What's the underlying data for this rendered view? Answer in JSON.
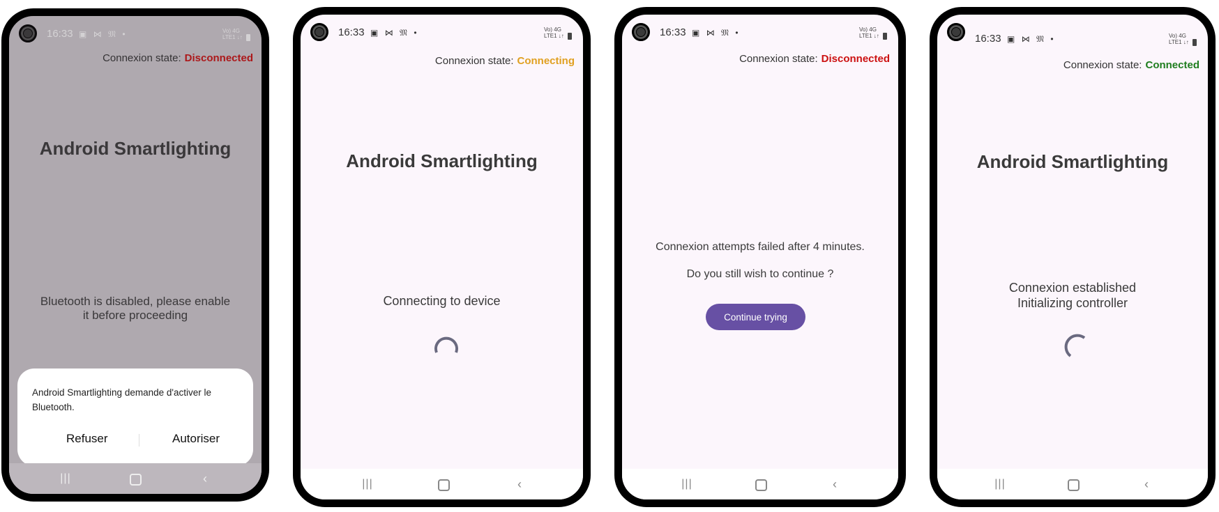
{
  "status_bar": {
    "time": "16:33",
    "left_icons": "▣ ⋈ 𝔐 •",
    "network_top": "Vo) 4G",
    "network_bottom": "LTE1 ↓↑"
  },
  "colors": {
    "disconnected": "#cc1111",
    "connecting": "#e0a020",
    "connected": "#1e7d1e",
    "primary_button": "#6750a4"
  },
  "screens": [
    {
      "connexion_label": "Connexion state:",
      "connexion_state": "Disconnected",
      "title": "Android Smartlighting",
      "message": "Bluetooth is disabled, please enable it before proceeding",
      "dialog": {
        "text": "Android Smartlighting demande d'activer le Bluetooth.",
        "refuse_label": "Refuser",
        "allow_label": "Autoriser"
      }
    },
    {
      "connexion_label": "Connexion state:",
      "connexion_state": "Connecting",
      "title": "Android Smartlighting",
      "message": "Connecting to device"
    },
    {
      "connexion_label": "Connexion state:",
      "connexion_state": "Disconnected",
      "message": "Connexion attempts failed after 4 minutes.",
      "question": "Do you still wish to continue ?",
      "button_label": "Continue trying"
    },
    {
      "connexion_label": "Connexion state:",
      "connexion_state": "Connected",
      "title": "Android Smartlighting",
      "message_line1": "Connexion established",
      "message_line2": "Initializing controller"
    }
  ],
  "nav": {
    "recents": "|||",
    "back": "‹"
  }
}
